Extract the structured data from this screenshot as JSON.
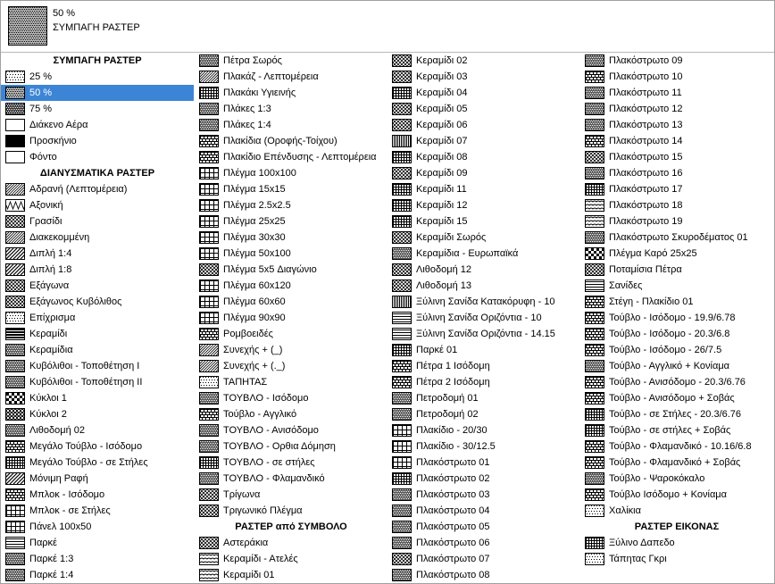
{
  "header": {
    "title": "50 %",
    "subtitle": "ΣΥΜΠΑΓΗ ΡΑΣΤΕΡ",
    "swatch": "dots50"
  },
  "columns": [
    [
      {
        "h": "ΣΥΜΠΑΓΗ ΡΑΣΤΕΡ"
      },
      {
        "label": "25 %",
        "pat": "dots25"
      },
      {
        "label": "50 %",
        "pat": "dots50",
        "selected": true
      },
      {
        "label": "75 %",
        "pat": "dots75"
      },
      {
        "label": "Διάκενο Αέρα",
        "pat": "blank"
      },
      {
        "label": "Προσκήνιο",
        "pat": "solid"
      },
      {
        "label": "Φόντο",
        "pat": "blank"
      },
      {
        "h": "ΔΙΑΝΥΣΜΑΤΙΚΑ ΡΑΣΤΕΡ"
      },
      {
        "label": "Αδρανή (Λεπτομέρεια)",
        "pat": "diag"
      },
      {
        "label": "Αξονική",
        "pat": "zigzag"
      },
      {
        "label": "Γρασίδι",
        "pat": "xhatch"
      },
      {
        "label": "Διακεκομμένη",
        "pat": "diag"
      },
      {
        "label": "Διπλή 1:4",
        "pat": "diagw"
      },
      {
        "label": "Διπλή 1:8",
        "pat": "diagw"
      },
      {
        "label": "Εξάγωνα",
        "pat": "xhatch"
      },
      {
        "label": "Εξάγωνος Κυβόλιθος",
        "pat": "xhatch"
      },
      {
        "label": "Επίχρισμα",
        "pat": "dots25"
      },
      {
        "label": "Κεραμίδι",
        "pat": "hstripe"
      },
      {
        "label": "Κεραμίδια",
        "pat": "dense"
      },
      {
        "label": "Κυβόλιθοι - Τοποθέτηση I",
        "pat": "dense"
      },
      {
        "label": "Κυβόλιθοι - Τοποθέτηση II",
        "pat": "dense"
      },
      {
        "label": "Κύκλοι 1",
        "pat": "checker"
      },
      {
        "label": "Κύκλοι 2",
        "pat": "circles"
      },
      {
        "label": "Λιθοδομή 02",
        "pat": "dense"
      },
      {
        "label": "Μεγάλο Τούβλο - Ισόδομο",
        "pat": "brick"
      },
      {
        "label": "Μεγάλο Τούβλο - σε Στήλες",
        "pat": "gridd"
      },
      {
        "label": "Μόνιμη Ραφή",
        "pat": "diagw"
      },
      {
        "label": "Μπλοκ - Ισόδομο",
        "pat": "brick"
      },
      {
        "label": "Μπλοκ - σε Στήλες",
        "pat": "grid"
      },
      {
        "label": "Πάνελ 100x50",
        "pat": "grid"
      },
      {
        "label": "Παρκέ",
        "pat": "hlines"
      },
      {
        "label": "Παρκέ 1:3",
        "pat": "dense"
      },
      {
        "label": "Παρκέ 1:4",
        "pat": "dense"
      }
    ],
    [
      {
        "label": "Πέτρα Σωρός",
        "pat": "dense"
      },
      {
        "label": "Πλακάζ - Λεπτομέρεια",
        "pat": "diag"
      },
      {
        "label": "Πλακάκι Υγιεινής",
        "pat": "gridd"
      },
      {
        "label": "Πλάκες 1:3",
        "pat": "dense"
      },
      {
        "label": "Πλάκες 1:4",
        "pat": "dense"
      },
      {
        "label": "Πλακίδια (Οροφής-Τοίχου)",
        "pat": "brick"
      },
      {
        "label": "Πλακίδιο Επένδυσης - Λεπτομέρεια",
        "pat": "brick"
      },
      {
        "label": "Πλέγμα 100x100",
        "pat": "grid"
      },
      {
        "label": "Πλέγμα 15x15",
        "pat": "grid"
      },
      {
        "label": "Πλέγμα 2.5x2.5",
        "pat": "grid"
      },
      {
        "label": "Πλέγμα 25x25",
        "pat": "grid"
      },
      {
        "label": "Πλέγμα 30x30",
        "pat": "grid"
      },
      {
        "label": "Πλέγμα 50x100",
        "pat": "grid"
      },
      {
        "label": "Πλέγμα 5x5 Διαγώνιο",
        "pat": "xhatch"
      },
      {
        "label": "Πλέγμα 60x120",
        "pat": "grid"
      },
      {
        "label": "Πλέγμα 60x60",
        "pat": "grid"
      },
      {
        "label": "Πλέγμα 90x90",
        "pat": "grid"
      },
      {
        "label": "Ρομβοειδές",
        "pat": "brick"
      },
      {
        "label": "Συνεχής + (_)",
        "pat": "diag"
      },
      {
        "label": "Συνεχής + (._)",
        "pat": "diag"
      },
      {
        "label": "ΤΑΠΗΤΑΣ",
        "pat": "dots25"
      },
      {
        "label": "ΤΟΥΒΛΟ - Ισόδομο",
        "pat": "dense"
      },
      {
        "label": "Τούβλο - Αγγλικό",
        "pat": "brick"
      },
      {
        "label": "ΤΟΥΒΛΟ - Ανισόδομο",
        "pat": "dense"
      },
      {
        "label": "ΤΟΥΒΛΟ - Ορθια Δόμηση",
        "pat": "dense"
      },
      {
        "label": "ΤΟΥΒΛΟ - σε στήλες",
        "pat": "gridd"
      },
      {
        "label": "ΤΟΥΒΛΟ - Φλαμανδικό",
        "pat": "dense"
      },
      {
        "label": "Τρίγωνα",
        "pat": "xhatch"
      },
      {
        "label": "Τριγωνικό Πλέγμα",
        "pat": "xhatch"
      },
      {
        "h": "ΡΑΣΤΕΡ από ΣΥΜΒΟΛΟ"
      },
      {
        "label": "Αστεράκια",
        "pat": "xhatch"
      },
      {
        "label": "Κεραμίδι - Ατελές",
        "pat": "wave"
      },
      {
        "label": "Κεραμίδι 01",
        "pat": "wave"
      }
    ],
    [
      {
        "label": "Κεραμίδι 02",
        "pat": "xhatch"
      },
      {
        "label": "Κεραμίδι 03",
        "pat": "xhatch"
      },
      {
        "label": "Κεραμίδι 04",
        "pat": "gridd"
      },
      {
        "label": "Κεραμίδι 05",
        "pat": "xhatch"
      },
      {
        "label": "Κεραμίδι 06",
        "pat": "xhatch"
      },
      {
        "label": "Κεραμίδι 07",
        "pat": "vlines"
      },
      {
        "label": "Κεραμίδι 08",
        "pat": "gridd"
      },
      {
        "label": "Κεραμίδι 09",
        "pat": "xhatch"
      },
      {
        "label": "Κεραμίδι 11",
        "pat": "gridd"
      },
      {
        "label": "Κεραμίδι 12",
        "pat": "gridd"
      },
      {
        "label": "Κεραμίδι 15",
        "pat": "gridd"
      },
      {
        "label": "Κεραμίδι Σωρός",
        "pat": "xhatch"
      },
      {
        "label": "Κεραμίδια - Ευρωπαϊκά",
        "pat": "dense"
      },
      {
        "label": "Λιθοδομή 12",
        "pat": "xhatch"
      },
      {
        "label": "Λιθοδομή 13",
        "pat": "xhatch"
      },
      {
        "label": "Ξύλινη Σανίδα Κατακόρυφη - 10",
        "pat": "vlines"
      },
      {
        "label": "Ξύλινη Σανίδα Οριζόντια - 10",
        "pat": "hlines"
      },
      {
        "label": "Ξύλινη Σανίδα Οριζόντια - 14.15",
        "pat": "hlines"
      },
      {
        "label": "Παρκέ 01",
        "pat": "gridd"
      },
      {
        "label": "Πέτρα 1 Ισόδομη",
        "pat": "brick"
      },
      {
        "label": "Πέτρα 2 Ισόδομη",
        "pat": "brick"
      },
      {
        "label": "Πετροδομή 01",
        "pat": "dense"
      },
      {
        "label": "Πετροδομή 02",
        "pat": "dense"
      },
      {
        "label": "Πλακίδιο - 20/30",
        "pat": "grid"
      },
      {
        "label": "Πλακίδιο - 30/12.5",
        "pat": "grid"
      },
      {
        "label": "Πλακόστρωτο 01",
        "pat": "grid"
      },
      {
        "label": "Πλακόστρωτο 02",
        "pat": "gridd"
      },
      {
        "label": "Πλακόστρωτο 03",
        "pat": "dense"
      },
      {
        "label": "Πλακόστρωτο 04",
        "pat": "dense"
      },
      {
        "label": "Πλακόστρωτο 05",
        "pat": "dense"
      },
      {
        "label": "Πλακόστρωτο 06",
        "pat": "dense"
      },
      {
        "label": "Πλακόστρωτο 07",
        "pat": "xhatch"
      },
      {
        "label": "Πλακόστρωτο 08",
        "pat": "dense"
      }
    ],
    [
      {
        "label": "Πλακόστρωτο 09",
        "pat": "dense"
      },
      {
        "label": "Πλακόστρωτο 10",
        "pat": "brick"
      },
      {
        "label": "Πλακόστρωτο 11",
        "pat": "dense"
      },
      {
        "label": "Πλακόστρωτο 12",
        "pat": "dense"
      },
      {
        "label": "Πλακόστρωτο 13",
        "pat": "dense"
      },
      {
        "label": "Πλακόστρωτο 14",
        "pat": "brick"
      },
      {
        "label": "Πλακόστρωτο 15",
        "pat": "xhatch"
      },
      {
        "label": "Πλακόστρωτο 16",
        "pat": "dense"
      },
      {
        "label": "Πλακόστρωτο 17",
        "pat": "gridd"
      },
      {
        "label": "Πλακόστρωτο 18",
        "pat": "wave"
      },
      {
        "label": "Πλακόστρωτο 19",
        "pat": "wave"
      },
      {
        "label": "Πλακόστρωτο Σκυροδέματος 01",
        "pat": "dense"
      },
      {
        "label": "Πλέγμα Καρό 25x25",
        "pat": "checker"
      },
      {
        "label": "Ποταμίσια Πέτρα",
        "pat": "xhatch"
      },
      {
        "label": "Σανίδες",
        "pat": "hlines"
      },
      {
        "label": "Στέγη - Πλακίδιο 01",
        "pat": "brick"
      },
      {
        "label": "Τούβλο - Ισόδομο - 19.9/6.78",
        "pat": "brick"
      },
      {
        "label": "Τούβλο - Ισόδομο - 20.3/6.8",
        "pat": "brick"
      },
      {
        "label": "Τούβλο - Ισόδομο - 26/7.5",
        "pat": "brick"
      },
      {
        "label": "Τούβλο - Αγγλικό + Κονίαμα",
        "pat": "dense"
      },
      {
        "label": "Τούβλο - Ανισόδομο - 20.3/6.76",
        "pat": "brick"
      },
      {
        "label": "Τούβλο - Ανισόδομο + Σοβάς",
        "pat": "brick"
      },
      {
        "label": "Τούβλο - σε Στήλες - 20.3/6.76",
        "pat": "gridd"
      },
      {
        "label": "Τούβλο - σε στήλες + Σοβάς",
        "pat": "gridd"
      },
      {
        "label": "Τούβλο - Φλαμανδικό - 10.16/6.8",
        "pat": "brick"
      },
      {
        "label": "Τούβλο - Φλαμανδικό + Σοβάς",
        "pat": "brick"
      },
      {
        "label": "Τούβλο - Ψαροκόκαλο",
        "pat": "dense"
      },
      {
        "label": "Τούβλο Ισόδομο + Κονίαμα",
        "pat": "brick"
      },
      {
        "label": "Χαλίκια",
        "pat": "dots25"
      },
      {
        "h": "ΡΑΣΤΕΡ ΕΙΚΟΝΑΣ"
      },
      {
        "label": "Ξύλινο Δαπεδο",
        "pat": "gridd"
      },
      {
        "label": "Τάπητας Γκρι",
        "pat": "dots25"
      }
    ]
  ],
  "colors": {
    "selection": "#3c85d6",
    "border": "#a0a0a0"
  }
}
